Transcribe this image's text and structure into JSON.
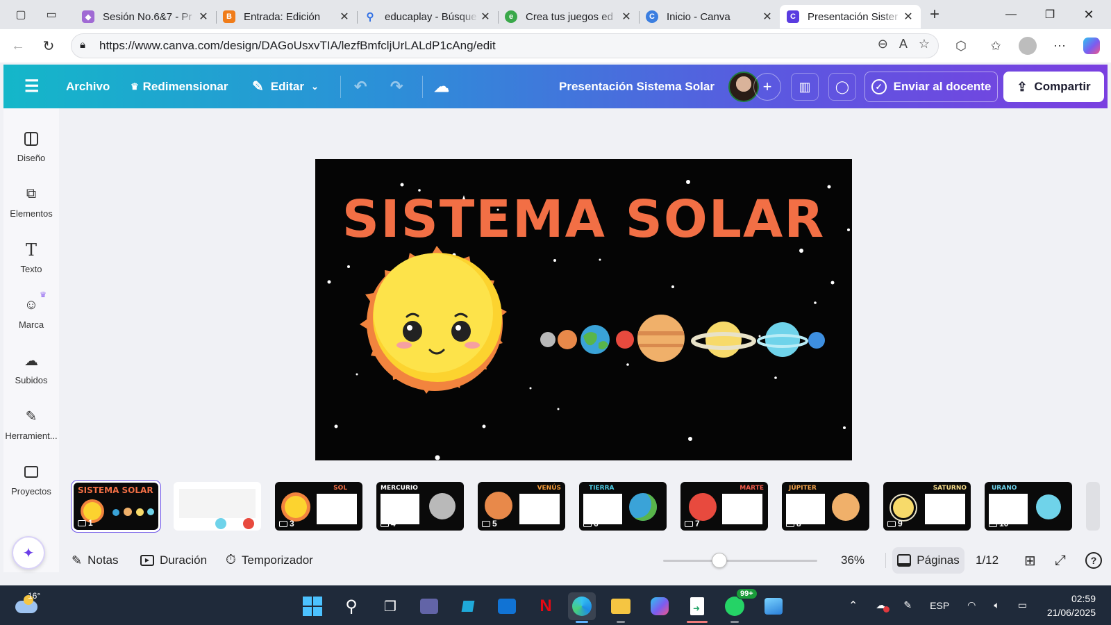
{
  "browser": {
    "tabs": [
      {
        "title": "Sesión No.6&7 - Pr",
        "favicon_color": "#a06ad4",
        "active": false
      },
      {
        "title": "Entrada: Edición",
        "favicon_color": "#f07c19",
        "active": false
      },
      {
        "title": "educaplay - Búsque",
        "favicon_color": "#2f6fe4",
        "active": false
      },
      {
        "title": "Crea tus juegos ed",
        "favicon_color": "#3aa84a",
        "active": false
      },
      {
        "title": "Inicio - Canva",
        "favicon_color": "#3b7ee0",
        "active": false
      },
      {
        "title": "Presentación Sister",
        "favicon_color": "#5a3ce0",
        "active": true
      }
    ],
    "url": "https://www.canva.com/design/DAGoUsxvTIA/lezfBmfcljUrLALdP1cAng/edit"
  },
  "canva": {
    "menu": {
      "archivo": "Archivo",
      "redimensionar": "Redimensionar",
      "editar": "Editar"
    },
    "doc_title": "Presentación Sistema Solar",
    "send_label": "Enviar al docente",
    "share_label": "Compartir",
    "sidebar": [
      {
        "label": "Diseño",
        "icon": "layout-icon"
      },
      {
        "label": "Elementos",
        "icon": "shapes-icon"
      },
      {
        "label": "Texto",
        "icon": "text-icon"
      },
      {
        "label": "Marca",
        "icon": "brand-icon"
      },
      {
        "label": "Subidos",
        "icon": "cloud-upload-icon"
      },
      {
        "label": "Herramient...",
        "icon": "pen-tool-icon"
      },
      {
        "label": "Proyectos",
        "icon": "folder-icon"
      }
    ],
    "slide": {
      "title": "SISTEMA SOLAR"
    },
    "thumbnails": [
      {
        "num": "1",
        "heading": "SISTEMA SOLAR",
        "heading_color": "#f26f45"
      },
      {
        "num": "2",
        "heading": "",
        "heading_color": "#000000"
      },
      {
        "num": "3",
        "heading": "SOL",
        "heading_color": "#f26f45"
      },
      {
        "num": "4",
        "heading": "MERCURIO",
        "heading_color": "#ffffff"
      },
      {
        "num": "5",
        "heading": "VENÚS",
        "heading_color": "#f29a3a"
      },
      {
        "num": "6",
        "heading": "TIERRA",
        "heading_color": "#4fd0e8"
      },
      {
        "num": "7",
        "heading": "MARTE",
        "heading_color": "#ef5a4a"
      },
      {
        "num": "8",
        "heading": "JÚPITER",
        "heading_color": "#f2a24a"
      },
      {
        "num": "9",
        "heading": "SATURNO",
        "heading_color": "#f6dc8a"
      },
      {
        "num": "10",
        "heading": "URANO",
        "heading_color": "#6fd3ea"
      }
    ],
    "bottom": {
      "notas": "Notas",
      "duracion": "Duración",
      "temporizador": "Temporizador",
      "zoom": "36%",
      "paginas": "Páginas",
      "page_count": "1/12"
    }
  },
  "taskbar": {
    "temperature": "16°",
    "language": "ESP",
    "badge": "99+",
    "time": "02:59",
    "date": "21/06/2025"
  }
}
